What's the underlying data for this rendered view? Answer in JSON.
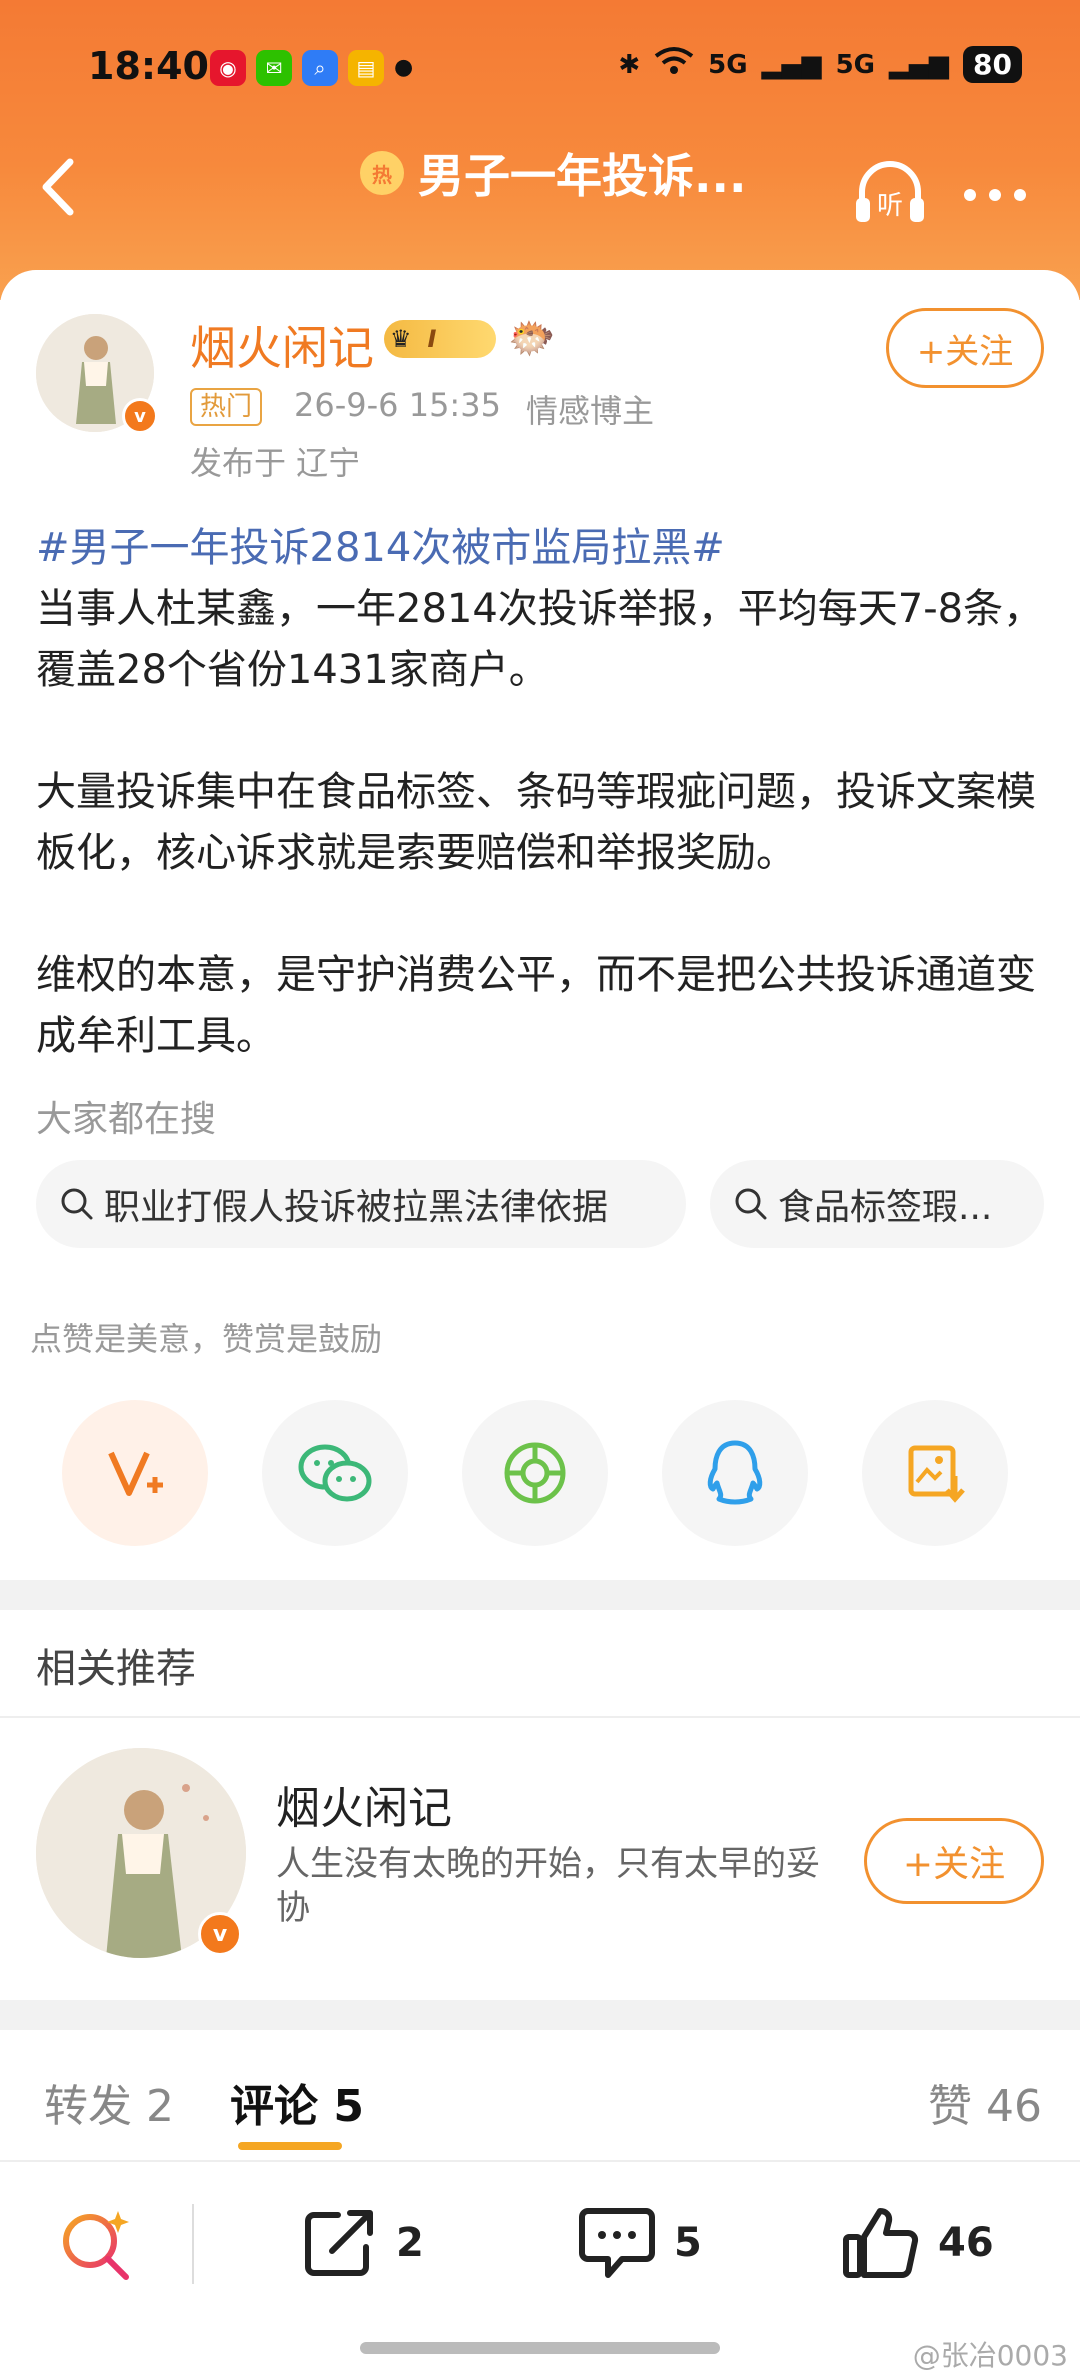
{
  "status": {
    "time": "18:40",
    "battery": "80",
    "signal1": "5G",
    "signal2": "5G"
  },
  "nav": {
    "hot_badge": "热",
    "title": "男子一年投诉...",
    "listen_label": "听"
  },
  "post": {
    "author": "烟火闲记",
    "level": "I",
    "hot_tag": "热门",
    "time": "26-9-6 15:35",
    "role": "情感博主",
    "location": "发布于 辽宁",
    "follow_label": "+关注",
    "hashtag": "#男子一年投诉2814次被市监局拉黑#",
    "paragraph1": "当事人杜某鑫，一年2814次投诉举报，平均每天7-8条，覆盖28个省份1431家商户。",
    "paragraph2": "大量投诉集中在食品标签、条码等瑕疵问题，投诉文案模板化，核心诉求就是索要赔偿和举报奖励。",
    "paragraph3": "维权的本意，是守护消费公平，而不是把公共投诉通道变成牟利工具。"
  },
  "search": {
    "title": "大家都在搜",
    "chips": [
      "职业打假人投诉被拉黑法律依据",
      "食品标签瑕..."
    ]
  },
  "reward": {
    "label": "点赞是美意，赞赏是鼓励"
  },
  "share_icons": [
    "reward-v-icon",
    "wechat-icon",
    "moments-icon",
    "qq-icon",
    "save-image-icon"
  ],
  "recommend": {
    "title": "相关推荐",
    "name": "烟火闲记",
    "desc": "人生没有太晚的开始，只有太早的妥协",
    "follow_label": "+关注"
  },
  "tabs": {
    "repost": "转发 2",
    "comment": "评论 5",
    "like": "赞 46"
  },
  "bottom": {
    "repost_count": "2",
    "comment_count": "5",
    "like_count": "46",
    "watermark": "@张冶0003"
  },
  "colors": {
    "header": "#f47a34",
    "accent": "#f2912f",
    "hashtag": "#4a6bb3"
  }
}
